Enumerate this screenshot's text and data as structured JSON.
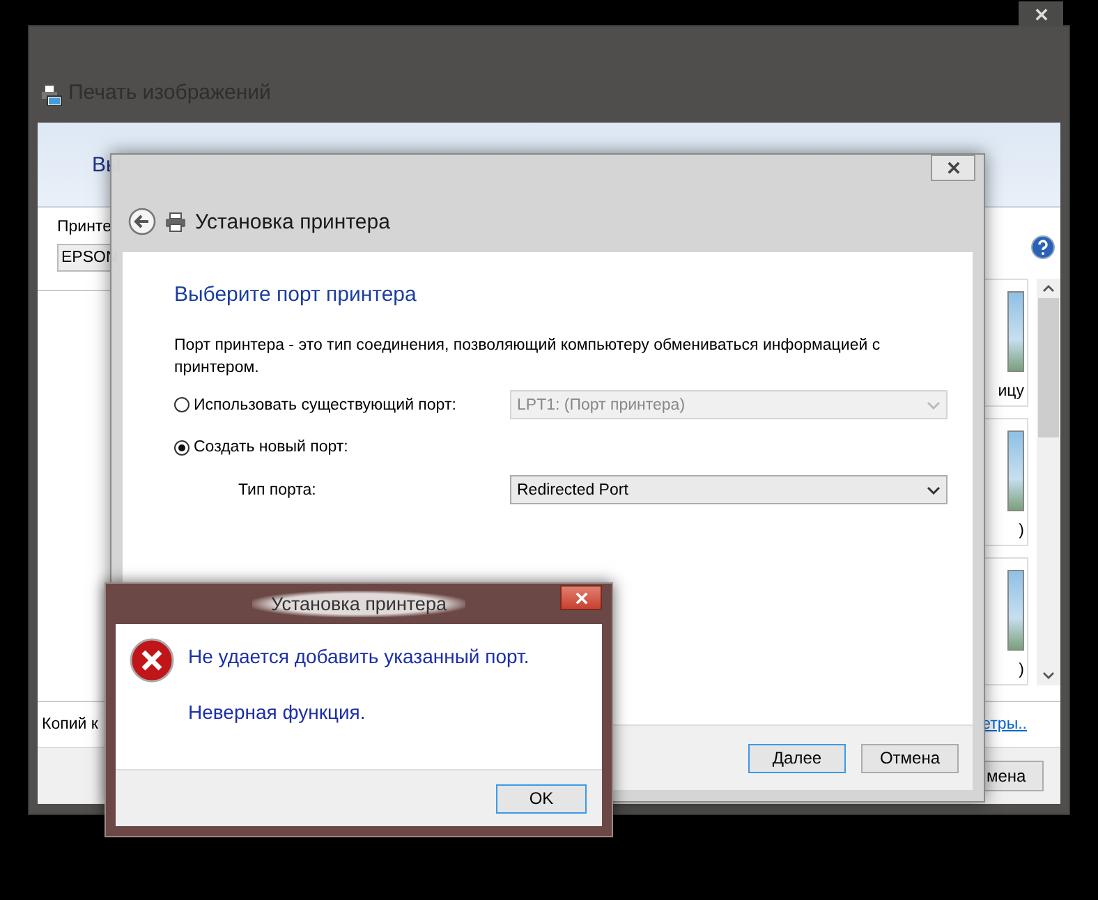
{
  "photo_print_window": {
    "title": "Печать изображений",
    "header": "Вы",
    "printer_label": "Принте",
    "printer_value": "EPSON",
    "thumbnail_captions": [
      "ицу",
      ")",
      ")"
    ],
    "copies_label": "Копий к",
    "options_link": "етры..",
    "cancel_button": "мена"
  },
  "wizard": {
    "title": "Установка принтера",
    "heading": "Выберите порт принтера",
    "description": "Порт принтера - это тип соединения, позволяющий компьютеру обмениваться информацией с принтером.",
    "port_options": [
      {
        "label": "Использовать существующий порт:",
        "selected": false,
        "select": {
          "value": "LPT1: (Порт принтера)",
          "disabled": true
        }
      },
      {
        "label": "Создать новый порт:",
        "selected": true
      }
    ],
    "port_type": {
      "label": "Тип порта:",
      "value": "Redirected Port",
      "disabled": false
    },
    "buttons": [
      {
        "label": "Далее",
        "default": true
      },
      {
        "label": "Отмена",
        "default": false
      }
    ]
  },
  "error_dialog": {
    "title": "Установка принтера",
    "message": "Не удается добавить указанный порт.",
    "detail": "Неверная функция.",
    "button": {
      "label": "OK",
      "default": true
    }
  }
}
